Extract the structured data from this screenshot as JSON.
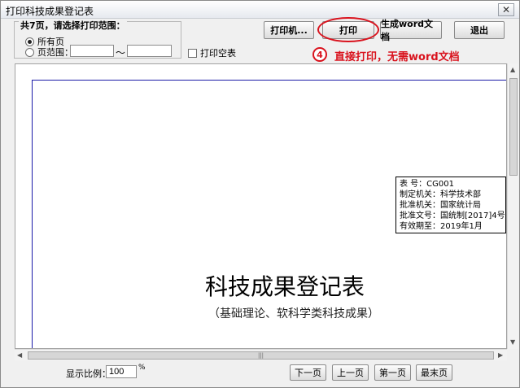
{
  "window": {
    "title": "打印科技成果登记表",
    "close_glyph": "✕"
  },
  "range": {
    "legend": "共7页，请选择打印范围：",
    "all_pages": "所有页",
    "page_range": "页范围：",
    "tilde": "～",
    "from_value": "",
    "to_value": ""
  },
  "print_blank": "打印空表",
  "toolbar": {
    "printer": "打印机...",
    "print": "打印",
    "generate_word": "生成word文档",
    "exit": "退出"
  },
  "annotation": {
    "step_number": "4",
    "note": "直接打印，无需word文档"
  },
  "document": {
    "info": [
      "表    号：CG001",
      "制定机关：科学技术部",
      "批准机关：国家统计局",
      "批准文号：国统制[2017]4号",
      "有效期至：2019年1月"
    ],
    "title": "科技成果登记表",
    "subtitle": "（基础理论、软科学类科技成果）"
  },
  "scrollbar": {
    "grip": "|||",
    "up": "▲",
    "down": "▼",
    "left": "◀",
    "right": "▶"
  },
  "footer": {
    "zoom_label": "显示比例：",
    "zoom_value": "100",
    "percent": "%",
    "next_page": "下一页",
    "prev_page": "上一页",
    "first_page": "第一页",
    "last_page": "最末页"
  },
  "colors": {
    "accent_red": "#d9121d",
    "page_border": "#1a1aa8"
  }
}
